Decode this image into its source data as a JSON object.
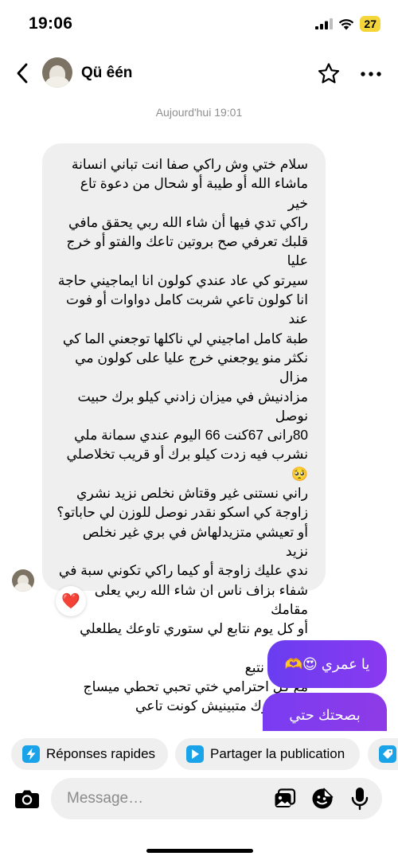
{
  "status_bar": {
    "time": "19:06",
    "battery": "27",
    "battery_color": "#f4d63a"
  },
  "header": {
    "contact_name": "Qü êén",
    "back_icon": "chevron-left-icon",
    "star_icon": "star-outline-icon",
    "more_icon": "more-horizontal-icon"
  },
  "conversation": {
    "timestamp": "Aujourd'hui 19:01",
    "incoming": {
      "text": "سلام ختي وش راكي صفا انت تباني انسانة\nماشاء الله أو طيبة أو شحال من دعوة تاع خير\nراكي تدي فيها أن شاء الله ربي يحقق مافي\nقلبك تعرفي صح بروتين تاعك والفتو أو خرج عليا\nسيرتو كي عاد عندي كولون انا ايماجيني حاجة\nانا كولون تاعي شربت كامل دواوات أو فوت عند\nطبة كامل اماجيني لي ناكلها توجعني الما كي\nنكثر منو يوجعني خرج عليا على كولون مي مزال\nمزادنيش في ميزان زادني كيلو برك حبيت نوصل\n80رانى 67كنت 66 اليوم عندي سمانة ملي\nنشرب فيه زدت كيلو برك أو قريب تخلاصلي 🥺\nراني نستنى غير وقتاش نخلص نزيد نشري\nزاوجة كي اسكو نقدر نوصل للوزن لي حاباتو؟\nأو تعيشي متزيدلهاش في بري غير نخلص نزيد\nندي عليك زاوجة أو كيما راكي تكوني سبة في\nشفاء بزاف ناس ان شاء الله ربي يعلى مقامك\nأو كل يوم نتابع لي ستوري تاوعك يطلعلي مورال\nكل يوم نتبع\nمع كل احترامي ختي تحبي تحطي ميساج\nحطيه برك متبينيش كونت تاعي",
      "reaction": "❤️",
      "bubble_color": "#efefef"
    },
    "outgoing": [
      {
        "text": "يا عمري 😍🫶"
      },
      {
        "text": "بصحتك حتي"
      }
    ],
    "accent_color": "#7b3cf0"
  },
  "quick_actions": [
    {
      "label": "Réponses rapides",
      "icon": "lightning-icon"
    },
    {
      "label": "Partager la publication",
      "icon": "play-icon"
    },
    {
      "label": "",
      "icon": "tag-icon"
    }
  ],
  "composer": {
    "placeholder": "Message…",
    "value": "",
    "camera_icon": "camera-icon",
    "gallery_icon": "gallery-icon",
    "sticker_icon": "sticker-icon",
    "mic_icon": "mic-icon"
  }
}
